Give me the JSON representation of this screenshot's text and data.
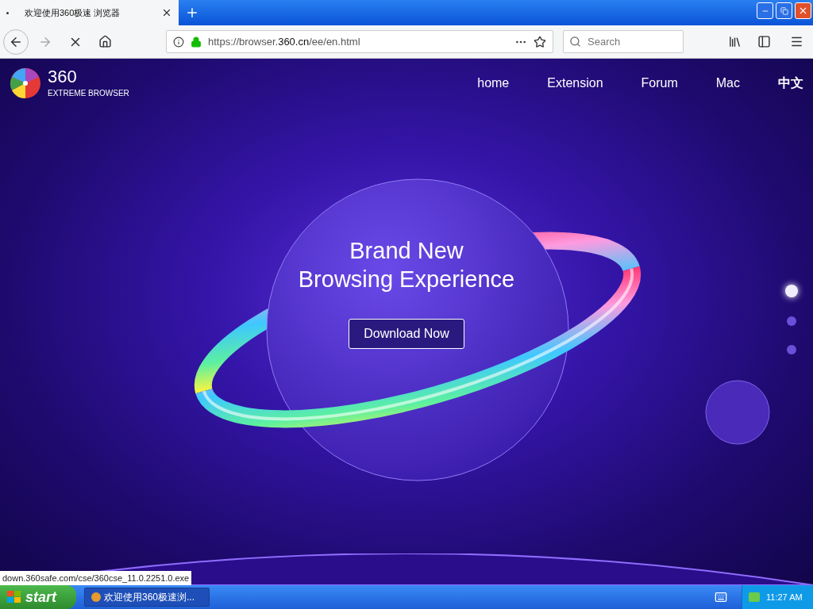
{
  "browser": {
    "tab": {
      "title": "欢迎使用360极速 浏览器",
      "selected": true
    },
    "address": {
      "url_prefix": "https://browser.",
      "url_domain": "360.cn",
      "url_path": "/ee/en.html"
    },
    "search": {
      "placeholder": "Search"
    },
    "status_url": "down.360safe.com/cse/360cse_11.0.2251.0.exe"
  },
  "page": {
    "logo": {
      "number": "360",
      "tagline": "EXTREME BROWSER"
    },
    "nav": [
      {
        "label": "home",
        "selected": false
      },
      {
        "label": "Extension",
        "selected": false
      },
      {
        "label": "Forum",
        "selected": false
      },
      {
        "label": "Mac",
        "selected": false
      },
      {
        "label": "中文",
        "selected": true
      }
    ],
    "headline": [
      "Brand New",
      "Browsing Experience"
    ],
    "cta": "Download Now",
    "slides": [
      {
        "selected": true
      },
      {
        "selected": false
      },
      {
        "selected": false
      }
    ]
  },
  "taskbar": {
    "start": "start",
    "task": "欢迎使用360极速浏...",
    "clock": "11:27 AM"
  }
}
